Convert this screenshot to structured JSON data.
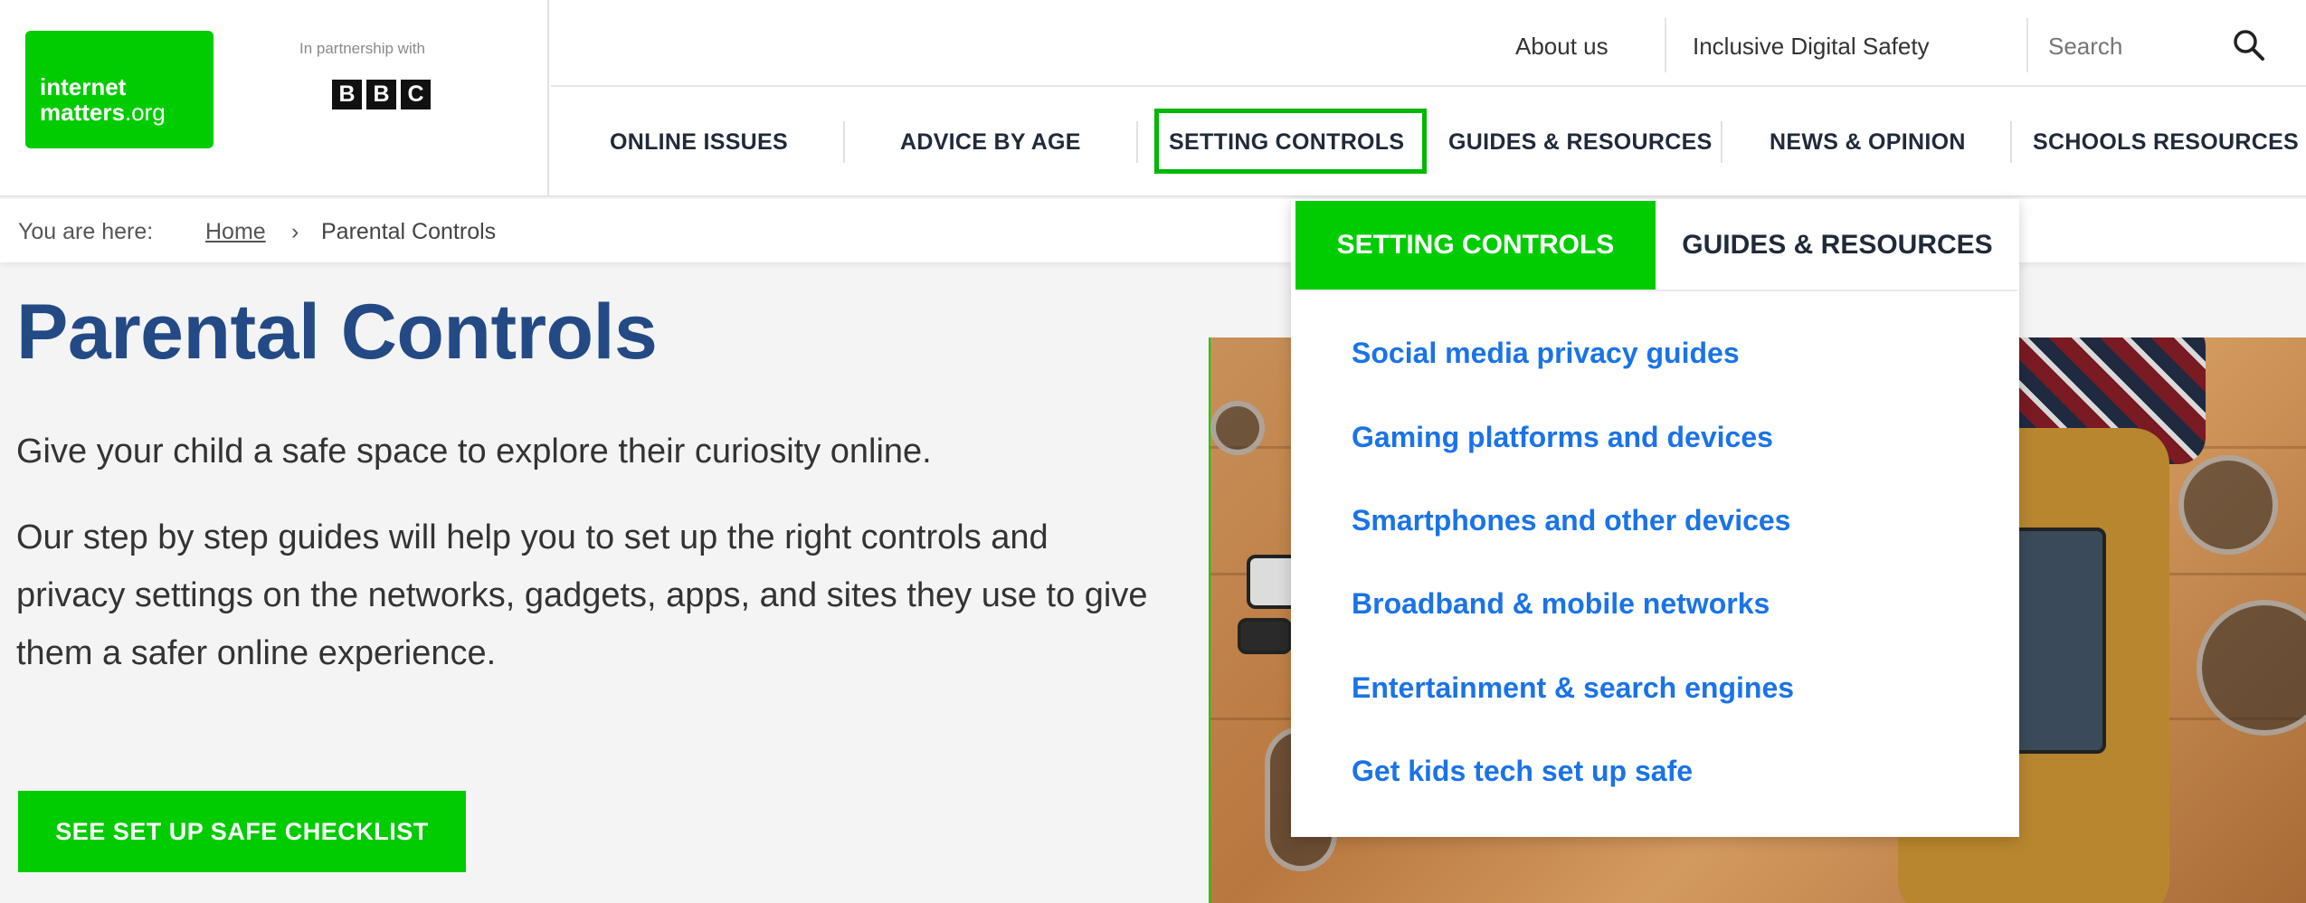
{
  "brand": {
    "logo_line1": "internet",
    "logo_line2_bold": "matters",
    "logo_line2_rest": ".org",
    "partner_text": "In partnership with",
    "partner_letters": [
      "B",
      "B",
      "C"
    ]
  },
  "topbar": {
    "about": "About us",
    "inclusive": "Inclusive Digital Safety",
    "search_placeholder": "Search"
  },
  "mainnav": {
    "online_issues": "ONLINE ISSUES",
    "advice_by_age": "ADVICE BY AGE",
    "setting_controls": "SETTING CONTROLS",
    "guides_resources": "GUIDES & RESOURCES",
    "news_opinion": "NEWS & OPINION",
    "schools_resources": "SCHOOLS RESOURCES"
  },
  "breadcrumb": {
    "label": "You are here:",
    "home": "Home",
    "separator": "›",
    "current": "Parental Controls"
  },
  "main": {
    "title": "Parental Controls",
    "intro": "Give your child a safe space to explore their curiosity online.",
    "body": "Our step by step guides will help you to set up the right controls and privacy settings on the networks, gadgets, apps, and sites they use to give them a safer online experience.",
    "cta": "SEE SET UP SAFE CHECKLIST"
  },
  "dropdown": {
    "tab_active": "SETTING CONTROLS",
    "tab_other": "GUIDES & RESOURCES",
    "links": [
      "Social media privacy guides",
      "Gaming platforms and devices",
      "Smartphones and other devices",
      "Broadband & mobile networks",
      "Entertainment & search engines",
      "Get kids tech set up safe"
    ]
  },
  "colors": {
    "brand_green": "#00cc00",
    "title_blue": "#234a85",
    "link_blue": "#1a73e8"
  }
}
